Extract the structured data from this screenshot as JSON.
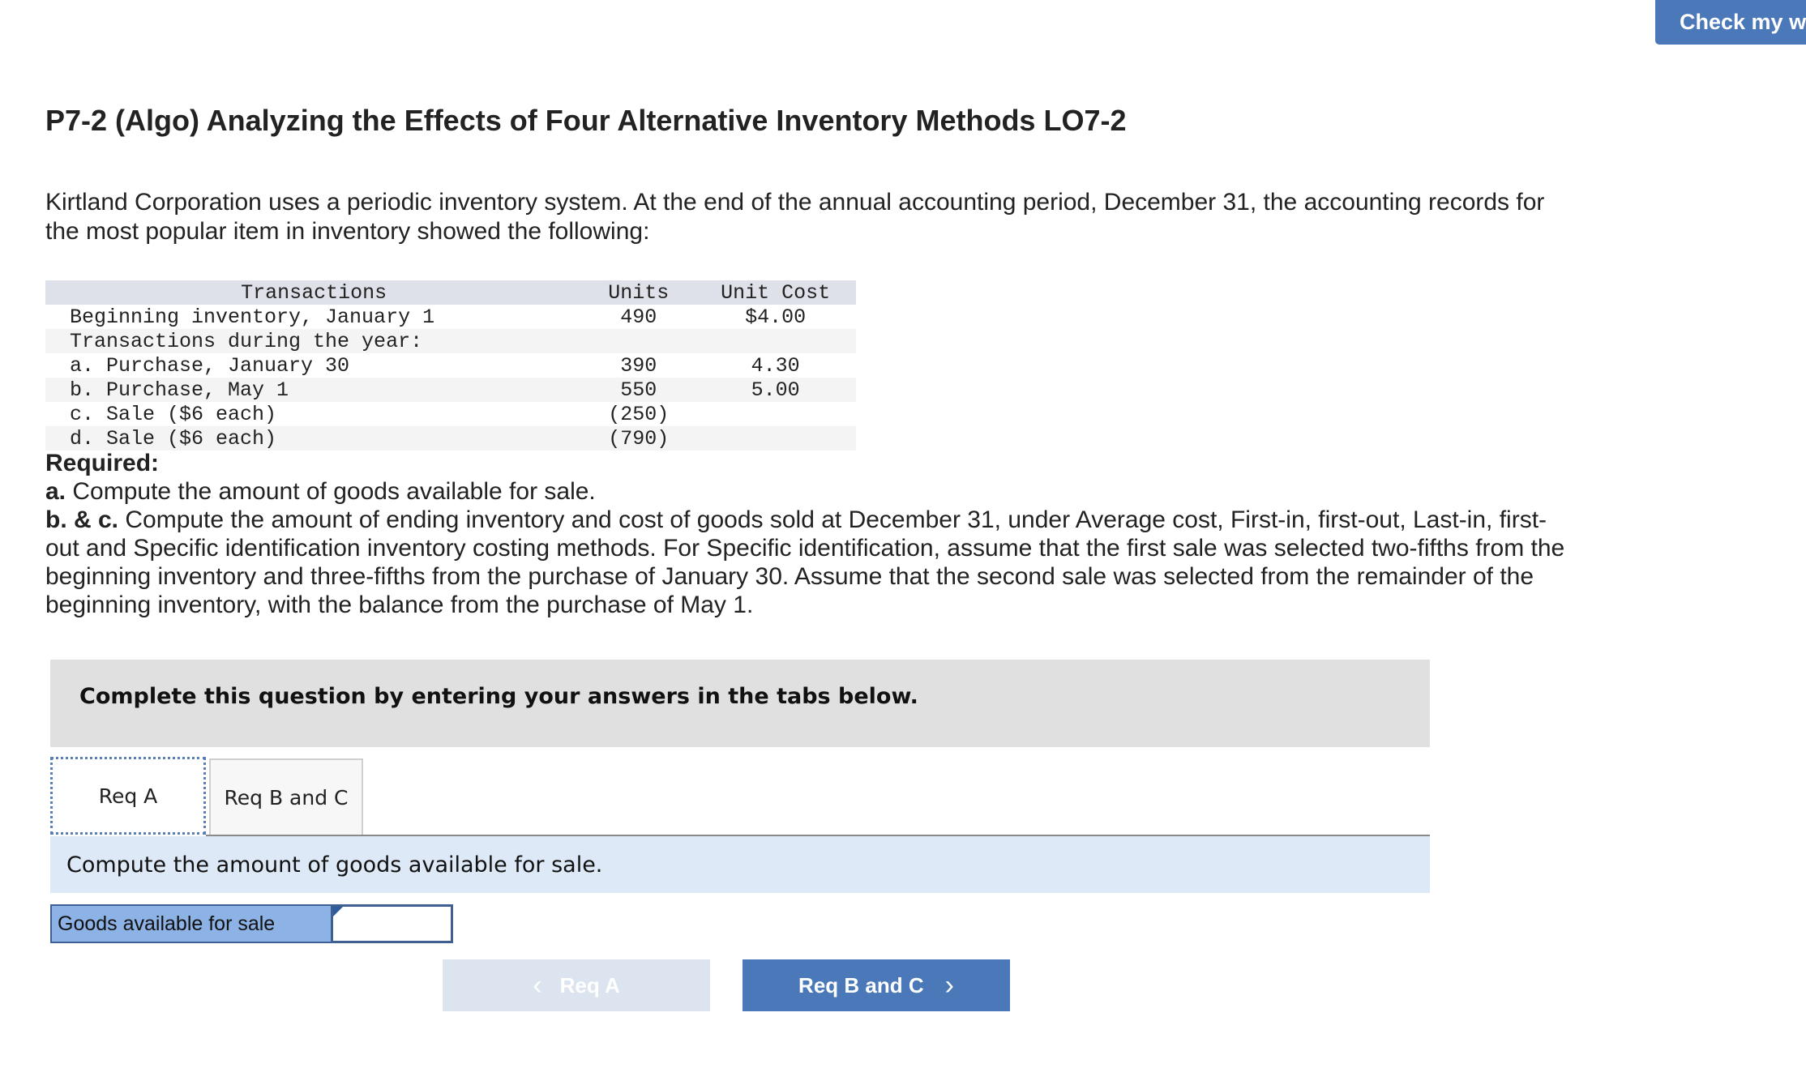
{
  "header": {
    "check_button": "Check my wo"
  },
  "title": "P7-2 (Algo) Analyzing the Effects of Four Alternative Inventory Methods LO7-2",
  "intro": "Kirtland Corporation uses a periodic inventory system. At the end of the annual accounting period, December 31, the accounting records for the most popular item in inventory showed the following:",
  "table": {
    "headers": [
      "Transactions",
      "Units",
      "Unit Cost"
    ],
    "rows": [
      [
        "Beginning inventory, January 1",
        "490",
        "$4.00"
      ],
      [
        "Transactions during the year:",
        "",
        ""
      ],
      [
        "a. Purchase, January 30",
        "390",
        "4.30"
      ],
      [
        "b. Purchase, May 1",
        "550",
        "5.00"
      ],
      [
        "c. Sale ($6 each)",
        "(250)",
        ""
      ],
      [
        "d. Sale ($6 each)",
        "(790)",
        ""
      ]
    ]
  },
  "required": {
    "heading": "Required:",
    "a_label": "a.",
    "a_text": " Compute the amount of goods available for sale.",
    "bc_label": "b. & c.",
    "bc_text": " Compute the amount of ending inventory and cost of goods sold at December 31, under Average cost, First-in, first-out, Last-in, first-out and Specific identification inventory costing methods. For Specific identification, assume that the first sale was selected two-fifths from the beginning inventory and three-fifths from the purchase of January 30. Assume that the second sale was selected from the remainder of the beginning inventory, with the balance from the purchase of May 1."
  },
  "instructions": "Complete this question by entering your answers in the tabs below.",
  "tabs": [
    {
      "label": "Req A",
      "active": true
    },
    {
      "label": "Req B and C",
      "active": false
    }
  ],
  "question": "Compute the amount of goods available for sale.",
  "answer": {
    "label": "Goods available for sale",
    "value": ""
  },
  "nav": {
    "prev_label": "Req A",
    "next_label": "Req B and C"
  }
}
